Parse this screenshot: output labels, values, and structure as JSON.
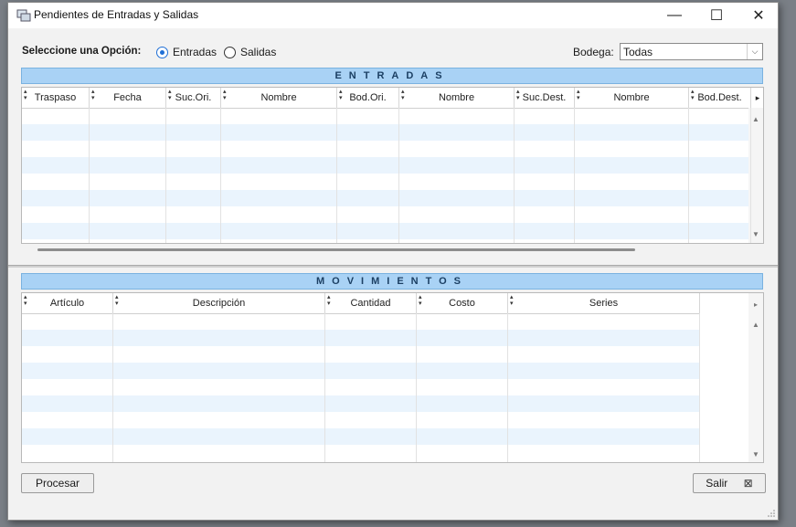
{
  "window": {
    "title": "Pendientes de Entradas y Salidas",
    "minimize": "—",
    "maximize": "☐",
    "close": "✕"
  },
  "options": {
    "label": "Seleccione una Opción:",
    "entradas": "Entradas",
    "salidas": "Salidas",
    "selected": "Entradas"
  },
  "bodega": {
    "label": "Bodega:",
    "value": "Todas"
  },
  "entradas": {
    "header": "ENTRADAS",
    "columns": [
      "Traspaso",
      "Fecha",
      "Suc.Ori.",
      "Nombre",
      "Bod.Ori.",
      "Nombre",
      "Suc.Dest.",
      "Nombre",
      "Bod.Dest."
    ]
  },
  "movimientos": {
    "header": "MOVIMIENTOS",
    "columns": [
      "Artículo",
      "Descripción",
      "Cantidad",
      "Costo",
      "Series"
    ]
  },
  "buttons": {
    "procesar": "Procesar",
    "salir": "Salir"
  },
  "colors": {
    "section_header_bg": "#a9d2f5",
    "row_alt": "#eaf4fd",
    "radio_accent": "#1f6fd6"
  }
}
